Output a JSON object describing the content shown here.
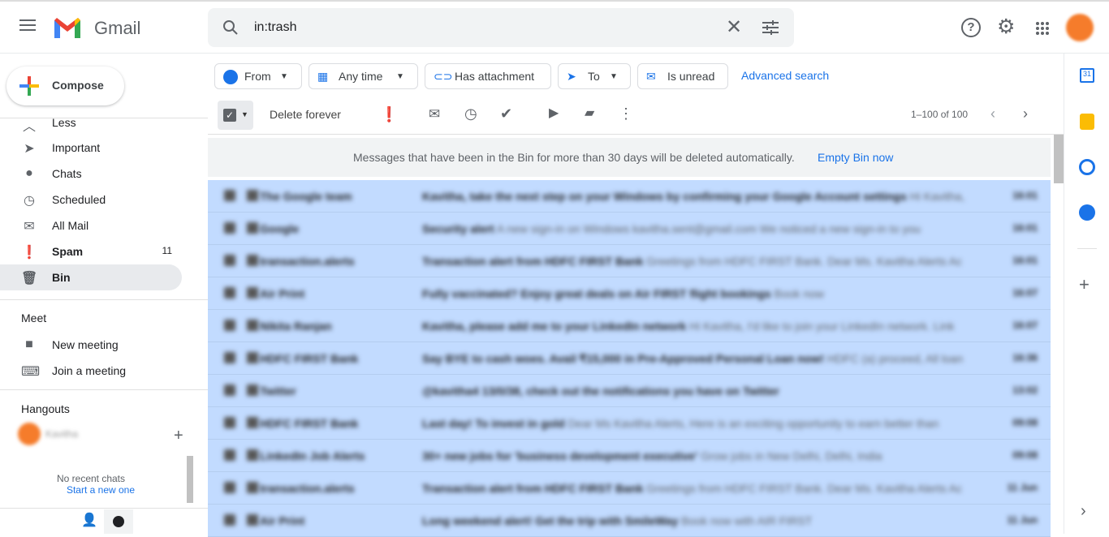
{
  "header": {
    "app_name": "Gmail",
    "search_query": "in:trash"
  },
  "compose_label": "Compose",
  "sidebar": {
    "items": [
      {
        "label": "Less",
        "icon": "chevron-up-icon"
      },
      {
        "label": "Important",
        "icon": "important-icon"
      },
      {
        "label": "Chats",
        "icon": "chat-icon"
      },
      {
        "label": "Scheduled",
        "icon": "scheduled-icon"
      },
      {
        "label": "All Mail",
        "icon": "mail-icon"
      },
      {
        "label": "Spam",
        "icon": "spam-icon",
        "count": "11"
      },
      {
        "label": "Bin",
        "icon": "trash-icon",
        "active": true
      }
    ],
    "meet": {
      "title": "Meet",
      "new_meeting": "New meeting",
      "join": "Join a meeting"
    },
    "hangouts": {
      "title": "Hangouts",
      "user": "Kavitha",
      "no_chats": "No recent chats",
      "start": "Start a new one"
    }
  },
  "filters": {
    "from": "From",
    "any_time": "Any time",
    "has_attachment": "Has attachment",
    "to": "To",
    "is_unread": "Is unread",
    "advanced": "Advanced search"
  },
  "toolbar": {
    "delete_forever": "Delete forever",
    "pagination": "1–100 of 100"
  },
  "banner": {
    "text": "Messages that have been in the Bin for more than 30 days will be deleted automatically.",
    "action": "Empty Bin now"
  },
  "emails": [
    {
      "sender": "The Google team",
      "subject": "Kavitha, take the next step on your Windows by confirming your Google Account settings",
      "snippet": "Hi Kavitha,",
      "time": "16:01"
    },
    {
      "sender": "Google",
      "subject": "Security alert",
      "snippet": "A new sign-in on Windows kavitha.sent@gmail.com We noticed a new sign-in to you",
      "time": "16:01"
    },
    {
      "sender": "transaction.alerts",
      "subject": "Transaction alert from HDFC FIRST Bank",
      "snippet": "Greetings from HDFC FIRST Bank. Dear Ms. Kavitha Alerts Ac",
      "time": "16:01"
    },
    {
      "sender": "Air Print",
      "subject": "Fully vaccinated? Enjoy great deals on Air FIRST flight bookings",
      "snippet": "Book now",
      "time": "16:07"
    },
    {
      "sender": "Nikita Ranjan",
      "subject": "Kavitha, please add me to your LinkedIn network",
      "snippet": "Hi Kavitha, I'd like to join your LinkedIn network. Link",
      "time": "16:07"
    },
    {
      "sender": "HDFC FIRST Bank",
      "subject": "Say BYE to cash woes. Avail ₹15,000 in Pre-Approved Personal Loan now!",
      "snippet": "HDFC (a) proceed, All loan",
      "time": "16:36"
    },
    {
      "sender": "Twitter",
      "subject": "@kavitha4 13/0/38, check out the notifications you have on Twitter",
      "snippet": "",
      "time": "13:02"
    },
    {
      "sender": "HDFC FIRST Bank",
      "subject": "Last day! To invest in gold",
      "snippet": "Dear Ms Kavitha Alerts, Here is an exciting opportunity to earn better than",
      "time": "09:08"
    },
    {
      "sender": "LinkedIn Job Alerts",
      "subject": "30+ new jobs for 'business development executive'",
      "snippet": "Grow jobs in New Delhi, Delhi, India",
      "time": "09:08"
    },
    {
      "sender": "transaction.alerts",
      "subject": "Transaction alert from HDFC FIRST Bank",
      "snippet": "Greetings from HDFC FIRST Bank. Dear Ms. Kavitha Alerts Ac",
      "time": "11 Jun"
    },
    {
      "sender": "Air Print",
      "subject": "Long weekend alert! Get the trip with SmileWay",
      "snippet": "Book now with AIR FIRST",
      "time": "11 Jun"
    }
  ],
  "colors": {
    "selected_row": "#c2dbff",
    "link": "#1a73e8",
    "avatar": "#f57c2b"
  }
}
